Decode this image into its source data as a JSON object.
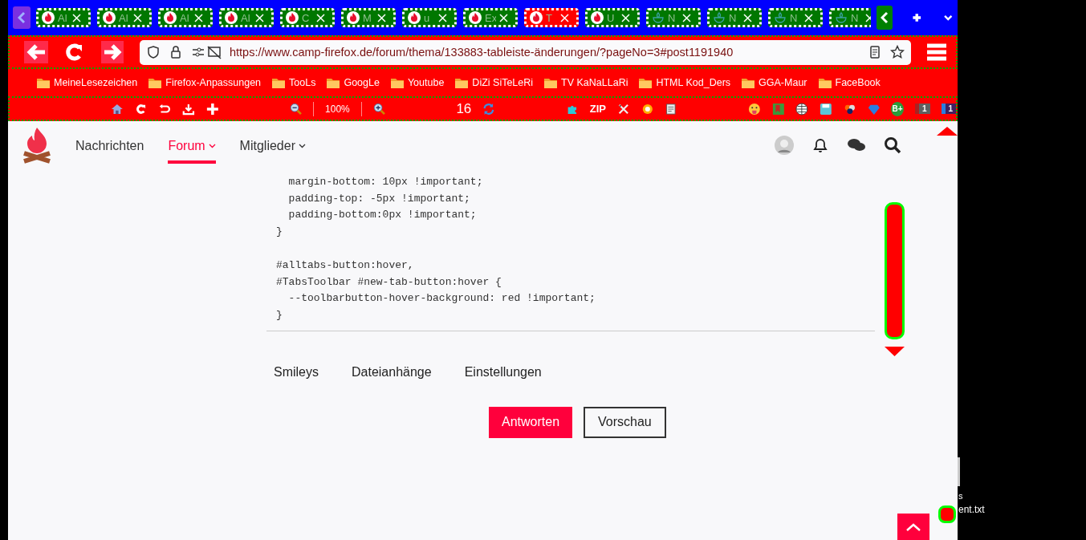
{
  "tabs": [
    {
      "label": "Al",
      "kind": "flame",
      "selected": false
    },
    {
      "label": "Al",
      "kind": "flame",
      "selected": false
    },
    {
      "label": "Al",
      "kind": "flame",
      "selected": false
    },
    {
      "label": "Al",
      "kind": "flame",
      "selected": false
    },
    {
      "label": "C",
      "kind": "flame",
      "selected": false
    },
    {
      "label": "M",
      "kind": "flame",
      "selected": false
    },
    {
      "label": "u",
      "kind": "flame",
      "selected": false
    },
    {
      "label": "Ex",
      "kind": "flame",
      "selected": false
    },
    {
      "label": "T",
      "kind": "flame",
      "selected": true
    },
    {
      "label": "U",
      "kind": "flame",
      "selected": false
    },
    {
      "label": "N",
      "kind": "outline",
      "selected": false
    },
    {
      "label": "N",
      "kind": "outline",
      "selected": false
    },
    {
      "label": "N",
      "kind": "outline",
      "selected": false
    },
    {
      "label": "N",
      "kind": "outline",
      "selected": false
    }
  ],
  "address_bar": {
    "url": "https://www.camp-firefox.de/forum/thema/133883-tableiste-änderungen/?pageNo=3#post1191940"
  },
  "bookmarks": [
    "MeineLesezeichen",
    "Firefox-Anpassungen",
    "TooLs",
    "GoogLe",
    "Youtube",
    "DiZi SiTeLeRi",
    "TV KaNaLLaRi",
    "HTML Kod_Ders",
    "GGA-Maur",
    "FaceBook"
  ],
  "toolbar": {
    "zoom": "100%",
    "counter": "16",
    "zip": "ZIP",
    "badge_b": "B+",
    "badges": [
      "1",
      "1"
    ]
  },
  "site_nav": [
    {
      "label": "Nachrichten",
      "selected": false,
      "dropdown": false
    },
    {
      "label": "Forum",
      "selected": true,
      "dropdown": true
    },
    {
      "label": "Mitglieder",
      "selected": false,
      "dropdown": true
    }
  ],
  "code_blocks": [
    [
      "  margin-bottom: 10px !important;",
      "  padding-top: -5px !important;",
      "  padding-bottom:0px !important;",
      "}"
    ],
    [
      "#alltabs-button:hover,",
      "#TabsToolbar #new-tab-button:hover {",
      "  --toolbarbutton-hover-background: red !important;",
      "}"
    ]
  ],
  "editor_tabs": [
    "Smileys",
    "Dateianhänge",
    "Einstellungen"
  ],
  "buttons": [
    {
      "label": "Antworten",
      "kind": "primary"
    },
    {
      "label": "Vorschau",
      "kind": "secondary"
    }
  ],
  "desktop": {
    "labels": [
      "s",
      "ent.txt"
    ]
  }
}
